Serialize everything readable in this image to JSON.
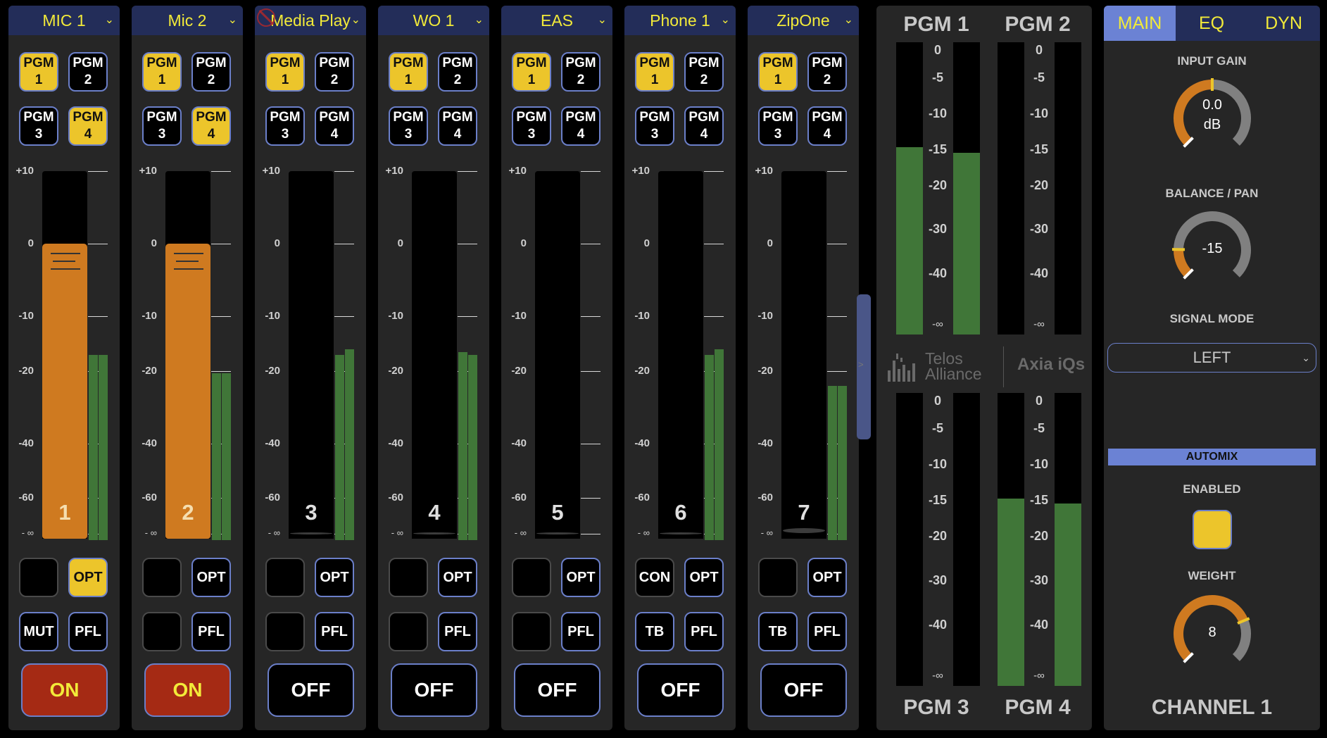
{
  "strips": [
    {
      "name": "MIC 1",
      "disabled": false,
      "pgm": [
        true,
        false,
        false,
        true
      ],
      "fader_db": 0,
      "fader_active": true,
      "meter_db": [
        -17,
        -17
      ],
      "row1": [
        {
          "label": "",
          "state": "blank"
        },
        {
          "label": "OPT",
          "state": "on"
        }
      ],
      "row2": [
        {
          "label": "MUT",
          "state": "off"
        },
        {
          "label": "PFL",
          "state": "off"
        }
      ],
      "onoff": "ON",
      "is_on": true,
      "number": "1"
    },
    {
      "name": "Mic 2",
      "disabled": false,
      "pgm": [
        true,
        false,
        false,
        true
      ],
      "fader_db": 0,
      "fader_active": true,
      "meter_db": [
        -20.5,
        -20.5
      ],
      "row1": [
        {
          "label": "",
          "state": "blank"
        },
        {
          "label": "OPT",
          "state": "off"
        }
      ],
      "row2": [
        {
          "label": "",
          "state": "blank"
        },
        {
          "label": "PFL",
          "state": "off"
        }
      ],
      "onoff": "ON",
      "is_on": true,
      "number": "2"
    },
    {
      "name": "Media Play",
      "disabled": true,
      "pgm": [
        true,
        false,
        false,
        false
      ],
      "fader_db": -999,
      "fader_active": false,
      "meter_db": [
        -17,
        -16
      ],
      "row1": [
        {
          "label": "",
          "state": "blank"
        },
        {
          "label": "OPT",
          "state": "off"
        }
      ],
      "row2": [
        {
          "label": "",
          "state": "blank"
        },
        {
          "label": "PFL",
          "state": "off"
        }
      ],
      "onoff": "OFF",
      "is_on": false,
      "number": "3"
    },
    {
      "name": "WO 1",
      "disabled": false,
      "pgm": [
        true,
        false,
        false,
        false
      ],
      "fader_db": -999,
      "fader_active": false,
      "meter_db": [
        -16.5,
        -17
      ],
      "row1": [
        {
          "label": "",
          "state": "blank"
        },
        {
          "label": "OPT",
          "state": "off"
        }
      ],
      "row2": [
        {
          "label": "",
          "state": "blank"
        },
        {
          "label": "PFL",
          "state": "off"
        }
      ],
      "onoff": "OFF",
      "is_on": false,
      "number": "4"
    },
    {
      "name": "EAS",
      "disabled": false,
      "pgm": [
        true,
        false,
        false,
        false
      ],
      "fader_db": -999,
      "fader_active": false,
      "meter_db": [
        -999,
        -999
      ],
      "row1": [
        {
          "label": "",
          "state": "blank"
        },
        {
          "label": "OPT",
          "state": "off"
        }
      ],
      "row2": [
        {
          "label": "",
          "state": "blank"
        },
        {
          "label": "PFL",
          "state": "off"
        }
      ],
      "onoff": "OFF",
      "is_on": false,
      "number": "5"
    },
    {
      "name": "Phone 1",
      "disabled": false,
      "pgm": [
        true,
        false,
        false,
        false
      ],
      "fader_db": -999,
      "fader_active": false,
      "meter_db": [
        -17,
        -16
      ],
      "row1": [
        {
          "label": "CON",
          "state": "dim"
        },
        {
          "label": "OPT",
          "state": "off"
        }
      ],
      "row2": [
        {
          "label": "TB",
          "state": "off"
        },
        {
          "label": "PFL",
          "state": "off"
        }
      ],
      "onoff": "OFF",
      "is_on": false,
      "number": "6"
    },
    {
      "name": "ZipOne",
      "disabled": false,
      "pgm": [
        true,
        false,
        false,
        false
      ],
      "fader_db": -65,
      "fader_active": false,
      "meter_db": [
        -24,
        -24
      ],
      "row1": [
        {
          "label": "",
          "state": "blank"
        },
        {
          "label": "OPT",
          "state": "off"
        }
      ],
      "row2": [
        {
          "label": "TB",
          "state": "off"
        },
        {
          "label": "PFL",
          "state": "off"
        }
      ],
      "onoff": "OFF",
      "is_on": false,
      "number": "7"
    }
  ],
  "pgm_labels": [
    "PGM\n1",
    "PGM\n2",
    "PGM\n3",
    "PGM\n4"
  ],
  "strip_scale": [
    {
      "label": "+10",
      "db": 10
    },
    {
      "label": "0",
      "db": 0
    },
    {
      "label": "-10",
      "db": -10
    },
    {
      "label": "-20",
      "db": -20
    },
    {
      "label": "-40",
      "db": -40
    },
    {
      "label": "-60",
      "db": -60
    },
    {
      "label": "- ∞",
      "db": -999
    }
  ],
  "pgm_meters": [
    {
      "title": "PGM 1",
      "levels_db": [
        -15,
        -15.7
      ]
    },
    {
      "title": "PGM 2",
      "levels_db": [
        -999,
        -999
      ]
    },
    {
      "title": "PGM 3",
      "levels_db": [
        -999,
        -999
      ]
    },
    {
      "title": "PGM 4",
      "levels_db": [
        -15,
        -15.7
      ]
    }
  ],
  "pgm_scale": [
    "0",
    "-5",
    "-10",
    "-15",
    "-20",
    "-30",
    "-40",
    "-∞"
  ],
  "logos": {
    "telos_line1": "Telos",
    "telos_line2": "Alliance",
    "axia": "Axia iQs"
  },
  "right_panel": {
    "tabs": [
      {
        "label": "MAIN",
        "active": true
      },
      {
        "label": "EQ",
        "active": false
      },
      {
        "label": "DYN",
        "active": false
      }
    ],
    "input_gain": {
      "label": "INPUT GAIN",
      "value": "0.0",
      "unit": "dB",
      "fraction": 0.5
    },
    "balance": {
      "label": "BALANCE / PAN",
      "value": "-15",
      "fraction": 0.17
    },
    "signal_mode": {
      "label": "SIGNAL MODE",
      "value": "LEFT"
    },
    "automix": {
      "header": "AUTOMIX",
      "enabled_label": "ENABLED",
      "enabled": true,
      "weight_label": "WEIGHT",
      "weight": "8",
      "fraction": 0.75
    },
    "channel_title": "CHANNEL 1"
  },
  "colors": {
    "accent_yellow": "#ecc52b",
    "fader_orange": "#cf7a20",
    "meter_green": "#407638",
    "on_red": "#a52a14",
    "header_navy": "#232d59",
    "border_blue": "#6b7fc9"
  }
}
